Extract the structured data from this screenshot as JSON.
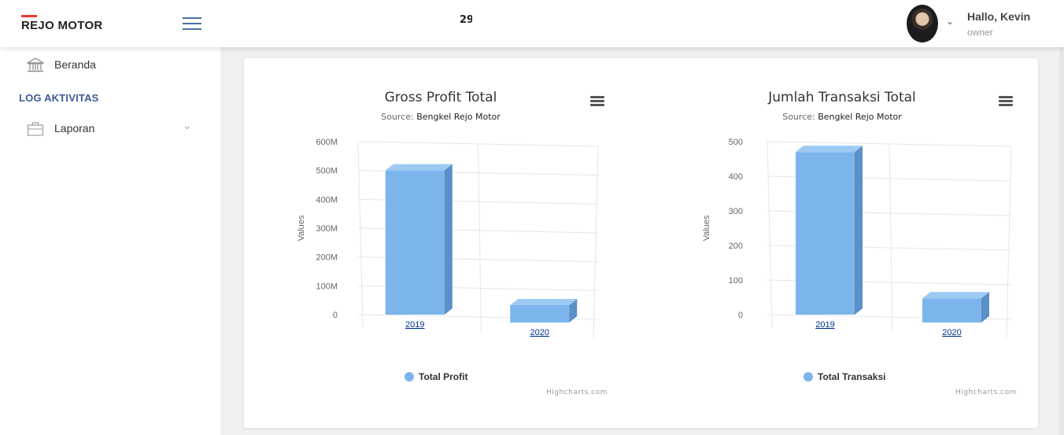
{
  "navbar": {
    "brand": "REJO MOTOR",
    "center_text": "29",
    "greeting": "Hallo, Kevin",
    "role": "owner"
  },
  "sidebar": {
    "items": [
      {
        "label": "Beranda",
        "icon": "bank-icon"
      },
      {
        "label": "Laporan",
        "icon": "briefcase-icon"
      }
    ],
    "section_title": "LOG AKTIVITAS"
  },
  "colors": {
    "accent": "#3b5998",
    "bar": "#7cb5ec",
    "logo_red": "#e53935"
  },
  "charts": [
    {
      "title": "Gross Profit Total",
      "source_label": "Source:",
      "source": "Bengkel Rejo Motor",
      "legend": "Total Profit",
      "credits": "Highcharts.com"
    },
    {
      "title": "Jumlah Transaksi Total",
      "source_label": "Source:",
      "source": "Bengkel Rejo Motor",
      "legend": "Total Transaksi",
      "credits": "Highcharts.com"
    }
  ],
  "chart_data": [
    {
      "type": "bar",
      "title": "Gross Profit Total",
      "subtitle": "Source: Bengkel Rejo Motor",
      "categories": [
        "2019",
        "2020"
      ],
      "series": [
        {
          "name": "Total Profit",
          "values": [
            500000000,
            60000000
          ]
        }
      ],
      "ylabel": "Values",
      "yticks": [
        "0",
        "100M",
        "200M",
        "300M",
        "400M",
        "500M",
        "600M"
      ],
      "ylim": [
        0,
        600000000
      ],
      "legend": "bottom-center",
      "grid": true
    },
    {
      "type": "bar",
      "title": "Jumlah Transaksi Total",
      "subtitle": "Source: Bengkel Rejo Motor",
      "categories": [
        "2019",
        "2020"
      ],
      "series": [
        {
          "name": "Total Transaksi",
          "values": [
            470,
            70
          ]
        }
      ],
      "ylabel": "Values",
      "yticks": [
        "0",
        "100",
        "200",
        "300",
        "400",
        "500"
      ],
      "ylim": [
        0,
        500
      ],
      "legend": "bottom-center",
      "grid": true
    }
  ]
}
